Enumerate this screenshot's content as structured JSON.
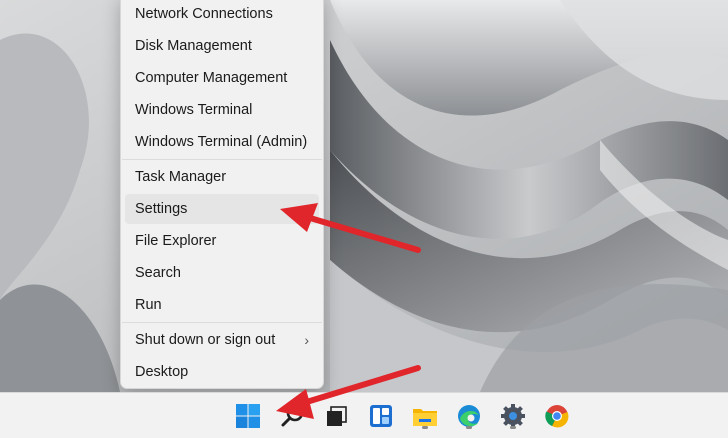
{
  "menu": {
    "items": [
      {
        "label": "Network Connections"
      },
      {
        "label": "Disk Management"
      },
      {
        "label": "Computer Management"
      },
      {
        "label": "Windows Terminal"
      },
      {
        "label": "Windows Terminal (Admin)"
      },
      {
        "label": "Task Manager"
      },
      {
        "label": "Settings"
      },
      {
        "label": "File Explorer"
      },
      {
        "label": "Search"
      },
      {
        "label": "Run"
      },
      {
        "label": "Shut down or sign out"
      },
      {
        "label": "Desktop"
      }
    ],
    "highlighted": "Settings",
    "submenu_chevron": "›"
  },
  "taskbar": {
    "icons": [
      "start-icon",
      "search-icon",
      "task-view-icon",
      "widgets-icon",
      "file-explorer-icon",
      "edge-icon",
      "settings-icon",
      "chrome-icon"
    ]
  },
  "annotations": {
    "arrow_color": "#e0262b"
  }
}
